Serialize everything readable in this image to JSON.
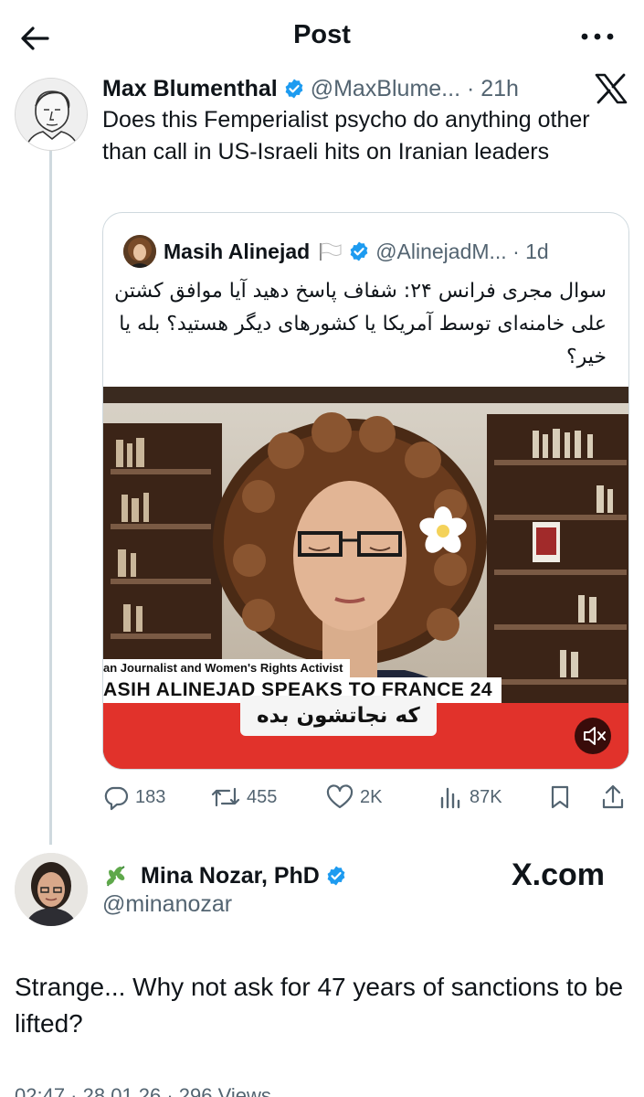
{
  "header": {
    "title": "Post"
  },
  "post": {
    "author_name": "Max Blumenthal",
    "handle_time": "@MaxBlume... · 21h",
    "text": "Does this Femperialist psycho do anything other than call in US-Israeli hits on Iranian leaders",
    "quote": {
      "author_name": "Masih Alinejad",
      "handle_time": "@AlinejadM... · 1d",
      "text": "سوال مجری فرانس ۲۴: شفاف پاسخ دهید آیا موافق کشتن علی خامنه‌ای توسط آمریکا یا کشورهای دیگر هستید؟ بله یا خیر؟",
      "video": {
        "ticker_top": "an Journalist and Women's Rights Activist",
        "ticker_bottom": "ASIH ALINEJAD SPEAKS TO FRANCE 24",
        "subtitle": "که نجاتشون بده"
      }
    },
    "stats": {
      "replies": "183",
      "reposts": "455",
      "likes": "2K",
      "views": "87K"
    }
  },
  "reply": {
    "author_name": "Mina Nozar, PhD",
    "handle": "@minanozar",
    "watermark": "X.com",
    "text": "Strange... Why not ask for 47 years of sanctions to be lifted?",
    "footer_partial": "02:47 · 28.01.26 · 296 Views"
  },
  "colors": {
    "verified_blue": "#1d9bf0",
    "muted_text": "#536471",
    "border": "#cfd9de"
  },
  "icons": [
    "back-arrow-icon",
    "more-icon",
    "x-logo-icon",
    "verified-icon",
    "flag-icon",
    "mute-icon",
    "reply-icon",
    "repost-icon",
    "like-icon",
    "views-icon",
    "bookmark-icon",
    "share-icon",
    "leaf-icon"
  ]
}
